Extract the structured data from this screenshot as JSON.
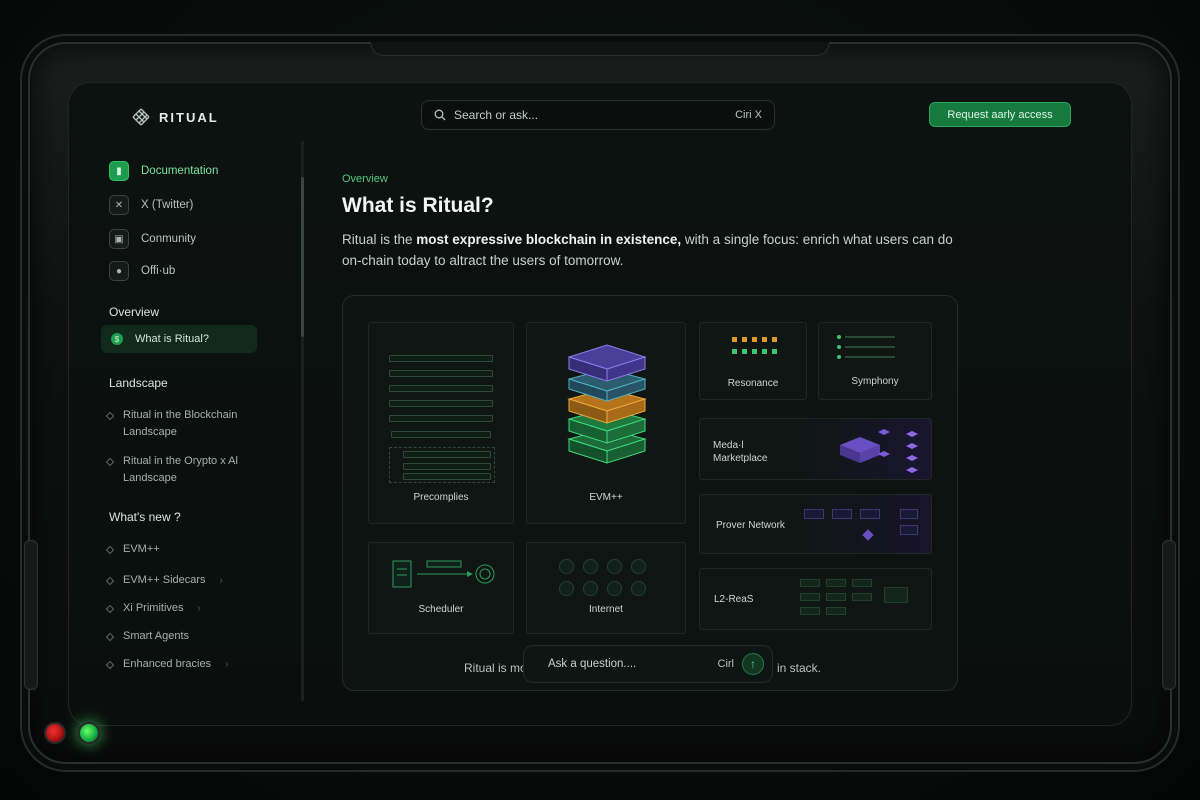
{
  "header": {
    "logo_text": "RITUAL",
    "search_placeholder": "Search or ask...",
    "search_shortcut": "Ciri X",
    "cta_label": "Request aarly access"
  },
  "sidebar": {
    "top_items": [
      {
        "label": "Documentation",
        "icon": "book-icon",
        "active": true
      },
      {
        "label": "X (Twitter)",
        "icon": "x-icon",
        "active": false
      },
      {
        "label": "Conmunity",
        "icon": "chat-icon",
        "active": false
      },
      {
        "label": "Offi·ub",
        "icon": "github-icon",
        "active": false
      }
    ],
    "sections": [
      {
        "heading": "Overview",
        "items": [
          {
            "label": "What is Ritual?",
            "selected": true
          }
        ]
      },
      {
        "heading": "Landscape",
        "items": [
          {
            "label": "Ritual in the Blockchain Landscape"
          },
          {
            "label": "Ritual in the Orypto x Al Landscape"
          }
        ]
      },
      {
        "heading": "What's new ?",
        "items": [
          {
            "label": "EVM++",
            "chevron": false
          },
          {
            "label": "EVM++ Sidecars",
            "chevron": true
          },
          {
            "label": "Xi Primitives",
            "chevron": true
          },
          {
            "label": "Smart Agents",
            "chevron": false
          },
          {
            "label": "Enhanced bracies",
            "chevron": true
          }
        ]
      }
    ]
  },
  "main": {
    "breadcrumb": "Overview",
    "title": "What is Ritual?",
    "lead_1": "Ritual is the ",
    "lead_2": "most expressive  blockchain in existence,",
    "lead_3": " with a single focus: enrich what users can do on-chain today to altract the users of tomorrow.",
    "cards": {
      "precompiles": "Precomplies",
      "evm": "EVM++",
      "resonance": "Resonance",
      "symphony": "Symphony",
      "model_marketplace": "Meda·l\nMarketplace",
      "prover_network": "Prover Network",
      "l2_reas": "L2-ReaS",
      "scheduler": "Scheduler",
      "internet": "Internet"
    },
    "under_left": "Ritual is mo",
    "under_right": "in stack.",
    "ask_placeholder": "Ask a question....",
    "ask_shortcut": "Cirl",
    "ask_send_icon": "arrow-up-icon"
  },
  "colors": {
    "accent": "#1e9c4d",
    "accent_text": "#58c983",
    "background": "#0a0f0d"
  }
}
